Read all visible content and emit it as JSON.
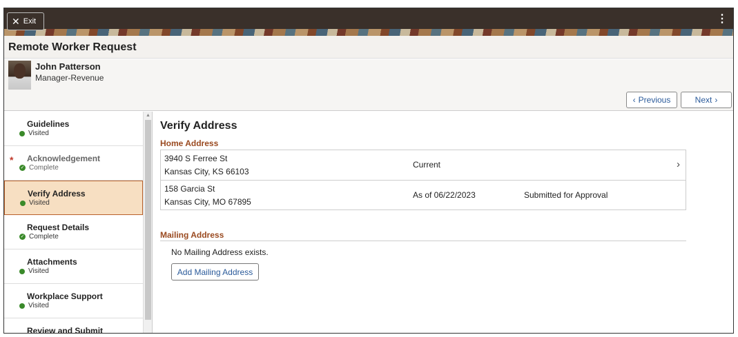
{
  "banner": {
    "exit_label": "Exit",
    "exit_icon": "close-icon",
    "menu_icon": "kebab-icon"
  },
  "page": {
    "title": "Remote Worker Request"
  },
  "employee": {
    "name": "John Patterson",
    "title": "Manager-Revenue"
  },
  "nav_buttons": {
    "previous": "Previous",
    "next": "Next"
  },
  "steps": [
    {
      "label": "Guidelines",
      "status": "Visited",
      "status_icon": "dot"
    },
    {
      "label": "Acknowledgement",
      "status": "Complete",
      "status_icon": "check",
      "required": true,
      "dimmed": true
    },
    {
      "label": "Verify Address",
      "status": "Visited",
      "status_icon": "dot",
      "active": true
    },
    {
      "label": "Request Details",
      "status": "Complete",
      "status_icon": "check"
    },
    {
      "label": "Attachments",
      "status": "Visited",
      "status_icon": "dot"
    },
    {
      "label": "Workplace Support",
      "status": "Visited",
      "status_icon": "dot"
    },
    {
      "label": "Review and Submit"
    }
  ],
  "main": {
    "title": "Verify Address",
    "home_address_title": "Home Address",
    "home_addresses": [
      {
        "line1": "3940 S Ferree St",
        "line2": "Kansas City, KS 66103",
        "when": "Current",
        "status": ""
      },
      {
        "line1": "158 Garcia St",
        "line2": "Kansas City, MO 67895",
        "when": "As of 06/22/2023",
        "status": "Submitted for Approval"
      }
    ],
    "mailing_address_title": "Mailing Address",
    "no_mailing_text": "No Mailing Address exists.",
    "add_mailing_label": "Add Mailing Address"
  },
  "colors": {
    "accent": "#9a4a20",
    "active_step_bg": "#f7dfc2",
    "status_green": "#3a8a2a",
    "link_blue": "#2a5a9a"
  }
}
